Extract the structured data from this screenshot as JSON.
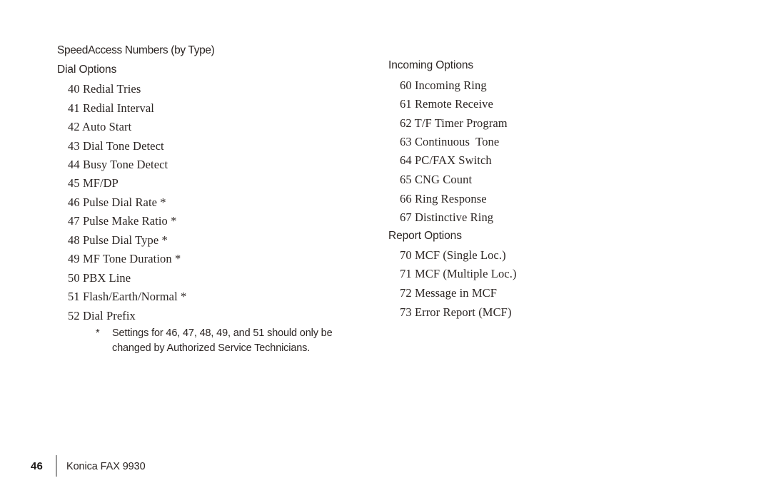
{
  "document": {
    "title_line": {
      "part1": "Speed",
      "part2": "Access Numbers (by Type)"
    }
  },
  "left_column": {
    "section_heading": "Dial Options",
    "items": [
      {
        "number": "40",
        "label": "Redial Tries"
      },
      {
        "number": "41",
        "label": "Redial Interval"
      },
      {
        "number": "42",
        "label": "Auto Start"
      },
      {
        "number": "43",
        "label": "Dial Tone Detect"
      },
      {
        "number": "44",
        "label": "Busy Tone Detect"
      },
      {
        "number": "45",
        "label": "MF/DP"
      },
      {
        "number": "46",
        "label": "Pulse Dial Rate *"
      },
      {
        "number": "47",
        "label": "Pulse Make Ratio *"
      },
      {
        "number": "48",
        "label": "Pulse Dial Type *"
      },
      {
        "number": "49",
        "label": "MF Tone Duration *"
      },
      {
        "number": "50",
        "label": "PBX Line"
      },
      {
        "number": "51",
        "label": "Flash/Earth/Normal *"
      },
      {
        "number": "52",
        "label": "Dial Prefix"
      }
    ],
    "footnote": {
      "marker": "*",
      "line1": "Settings for 46, 47, 48, 49, and 51 should only be",
      "line2": "changed by Authorized Service Technicians."
    }
  },
  "right_column": {
    "incoming": {
      "section_heading": "Incoming Options",
      "items": [
        {
          "number": "60",
          "label": "Incoming Ring"
        },
        {
          "number": "61",
          "label": "Remote Receive"
        },
        {
          "number": "62",
          "label": "T/F Timer Program"
        },
        {
          "number": "63",
          "label": "Continuous  Tone"
        },
        {
          "number": "64",
          "label": "PC/FAX Switch"
        },
        {
          "number": "65",
          "label": "CNG Count"
        },
        {
          "number": "66",
          "label": "Ring Response"
        },
        {
          "number": "67",
          "label": "Distinctive Ring"
        }
      ]
    },
    "report": {
      "section_heading": "Report Options",
      "items": [
        {
          "number": "70",
          "label": "MCF (Single Loc.)"
        },
        {
          "number": "71",
          "label": "MCF (Multiple Loc.)"
        },
        {
          "number": "72",
          "label": "Message in MCF"
        },
        {
          "number": "73",
          "label": "Error Report (MCF)"
        }
      ]
    }
  },
  "footer": {
    "page_number": "46",
    "product_title": "Konica FAX 9930"
  }
}
